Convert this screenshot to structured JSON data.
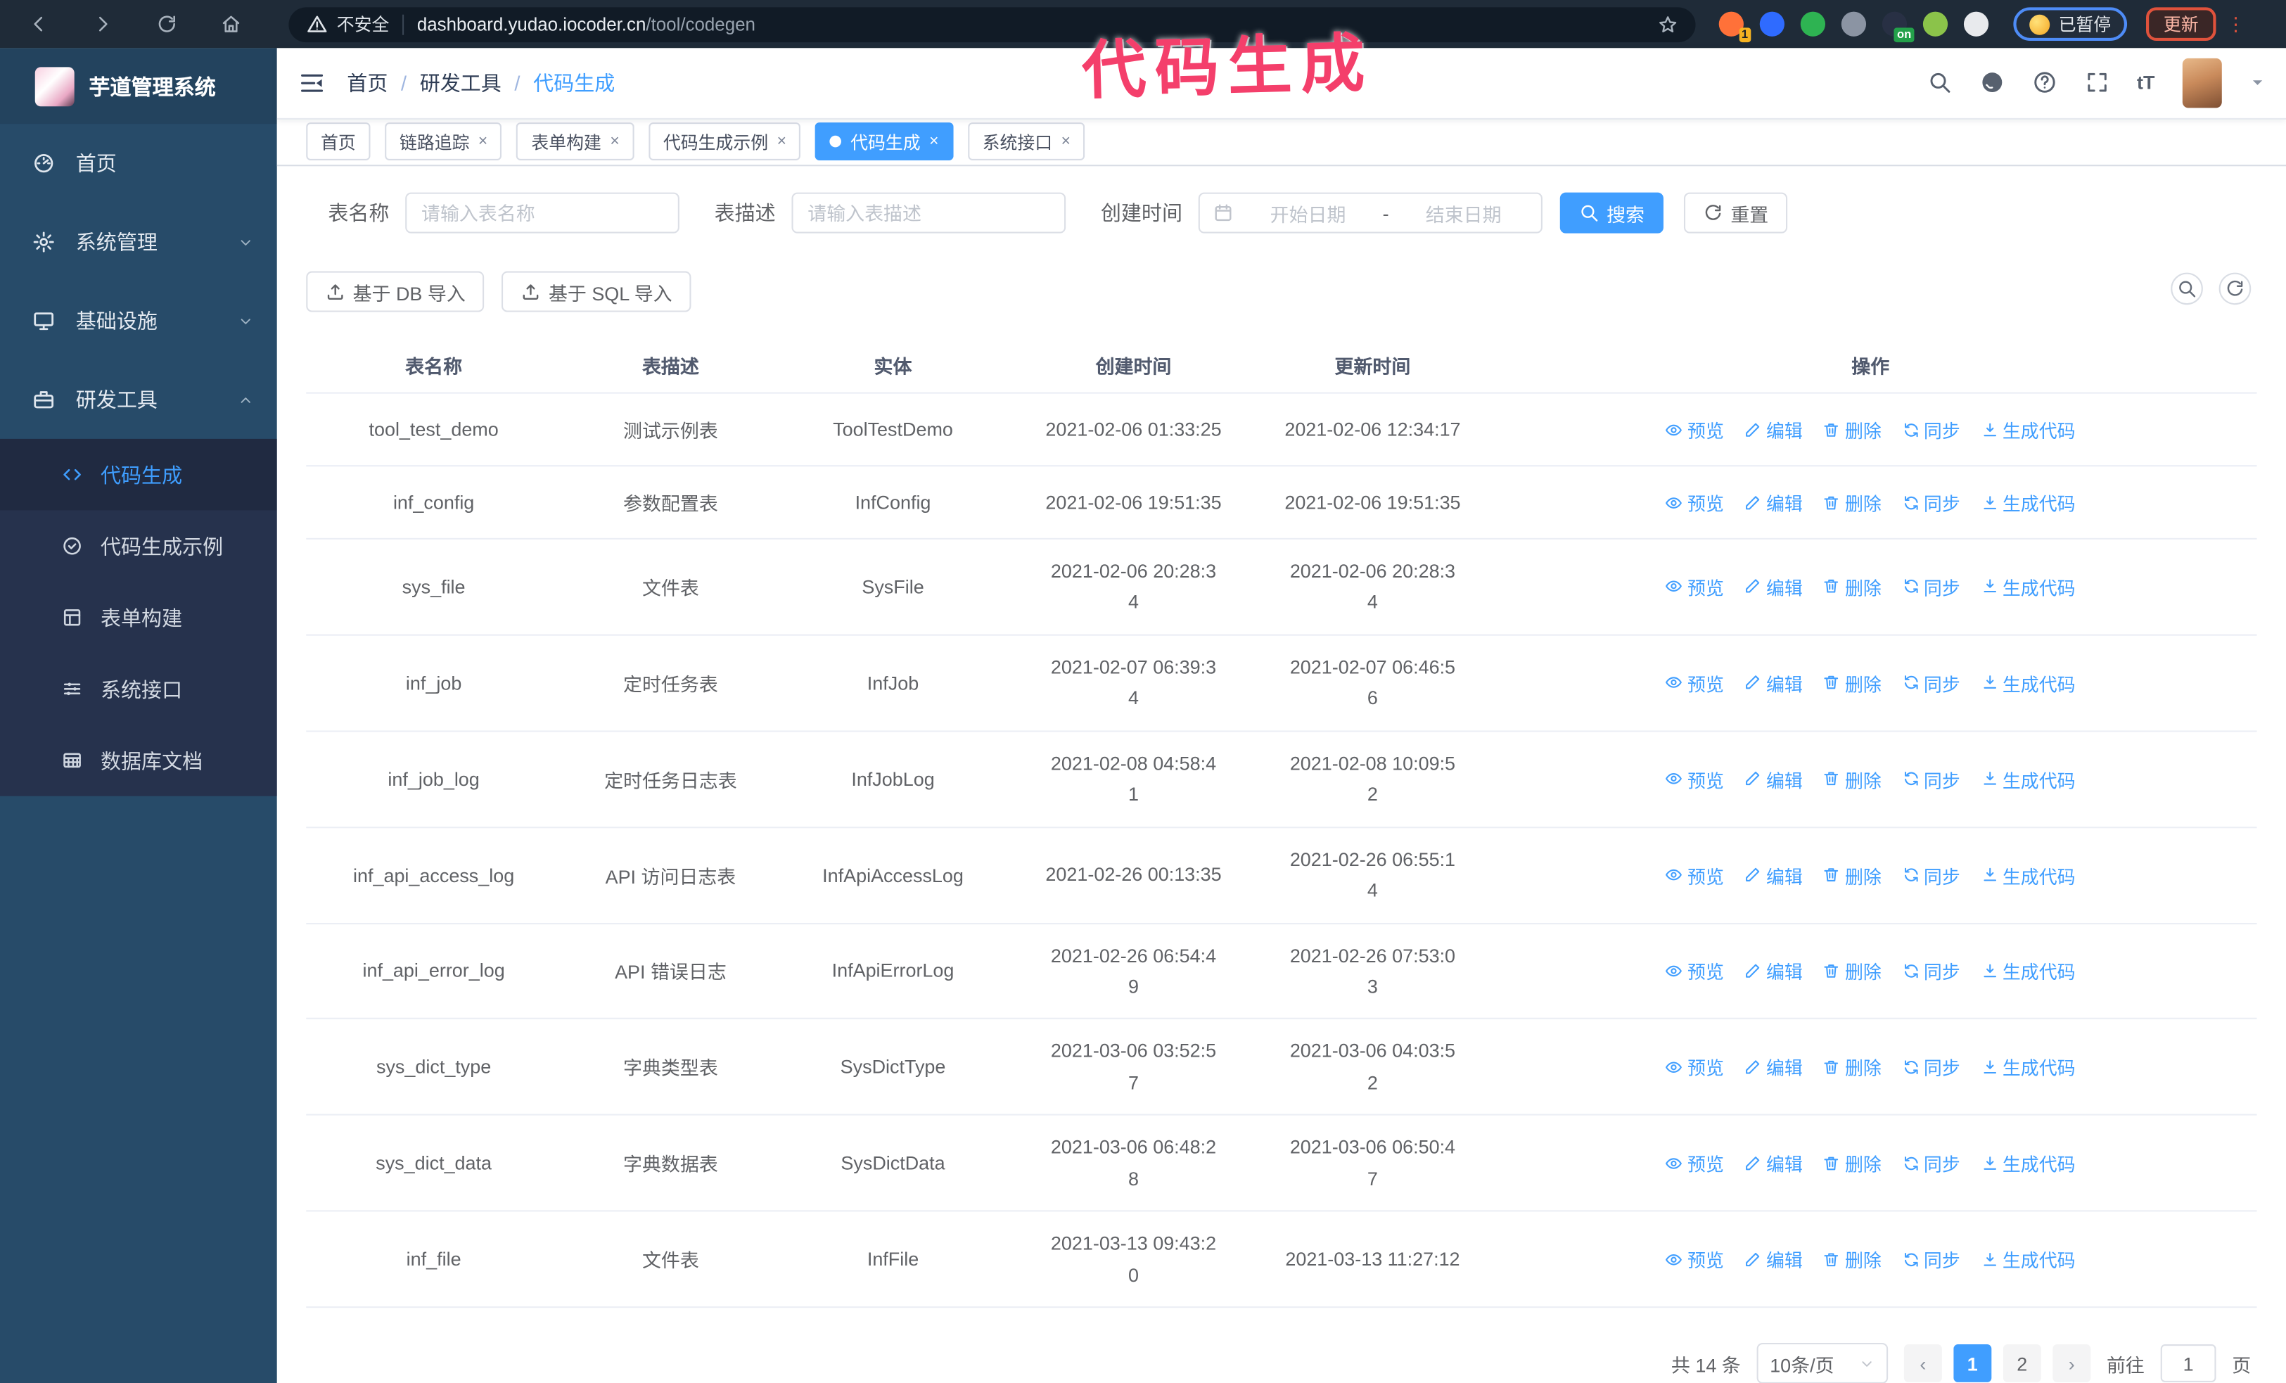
{
  "browser": {
    "security_label": "不安全",
    "url_host": "dashboard.yudao.iocoder.cn",
    "url_path": "/tool/codegen",
    "paused_badge": "已暂停",
    "update_label": "更新",
    "extensions": [
      {
        "icon": "adblock-extension-icon",
        "color": "#ff7139",
        "badge": "1"
      },
      {
        "icon": "gem-extension-icon",
        "color": "#2f6bff",
        "badge": ""
      },
      {
        "icon": "shield-check-extension-icon",
        "color": "#2eb352",
        "badge": ""
      },
      {
        "icon": "grid-extension-icon",
        "color": "#8b94a3",
        "badge": ""
      },
      {
        "icon": "dark-on-extension-icon",
        "color": "#283044",
        "badge": "on"
      },
      {
        "icon": "android-extension-icon",
        "color": "#8bc34a",
        "badge": ""
      },
      {
        "icon": "puzzle-extension-icon",
        "color": "#e8eaed",
        "badge": ""
      }
    ]
  },
  "annotation": {
    "text": "代码生成",
    "color": "#f43f6b"
  },
  "sidebar": {
    "title": "芋道管理系统",
    "items": [
      {
        "label": "首页",
        "icon": "dashboard-icon",
        "chevron": ""
      },
      {
        "label": "系统管理",
        "icon": "gear-icon",
        "chevron": "down"
      },
      {
        "label": "基础设施",
        "icon": "monitor-icon",
        "chevron": "down"
      },
      {
        "label": "研发工具",
        "icon": "briefcase-icon",
        "chevron": "up"
      }
    ],
    "submenu": [
      {
        "label": "代码生成",
        "icon": "code-icon",
        "active": true
      },
      {
        "label": "代码生成示例",
        "icon": "badge-check-icon",
        "active": false
      },
      {
        "label": "表单构建",
        "icon": "form-icon",
        "active": false
      },
      {
        "label": "系统接口",
        "icon": "sliders-icon",
        "active": false
      },
      {
        "label": "数据库文档",
        "icon": "database-doc-icon",
        "active": false
      }
    ]
  },
  "breadcrumb": {
    "0": "首页",
    "1": "研发工具",
    "2": "代码生成"
  },
  "tabs": [
    {
      "label": "首页",
      "closable": false,
      "active": false
    },
    {
      "label": "链路追踪",
      "closable": true,
      "active": false
    },
    {
      "label": "表单构建",
      "closable": true,
      "active": false
    },
    {
      "label": "代码生成示例",
      "closable": true,
      "active": false
    },
    {
      "label": "代码生成",
      "closable": true,
      "active": true
    },
    {
      "label": "系统接口",
      "closable": true,
      "active": false
    }
  ],
  "filters": {
    "name_label": "表名称",
    "name_placeholder": "请输入表名称",
    "desc_label": "表描述",
    "desc_placeholder": "请输入表描述",
    "time_label": "创建时间",
    "start_placeholder": "开始日期",
    "range_separator": "-",
    "end_placeholder": "结束日期",
    "search_label": "搜索",
    "reset_label": "重置"
  },
  "toolbar": {
    "db_import_label": "基于 DB 导入",
    "sql_import_label": "基于 SQL 导入"
  },
  "table": {
    "headers": [
      "表名称",
      "表描述",
      "实体",
      "创建时间",
      "更新时间",
      "操作"
    ],
    "action_labels": [
      "预览",
      "编辑",
      "删除",
      "同步",
      "生成代码"
    ],
    "action_icons": [
      "eye-icon",
      "edit-icon",
      "delete-icon",
      "sync-icon",
      "download-icon"
    ],
    "rows": [
      {
        "name": "tool_test_demo",
        "desc": "测试示例表",
        "entity": "ToolTestDemo",
        "created": "2021-02-06 01:33:25",
        "updated": "2021-02-06 12:34:17"
      },
      {
        "name": "inf_config",
        "desc": "参数配置表",
        "entity": "InfConfig",
        "created": "2021-02-06 19:51:35",
        "updated": "2021-02-06 19:51:35"
      },
      {
        "name": "sys_file",
        "desc": "文件表",
        "entity": "SysFile",
        "created": "2021-02-06 20:28:3\n4",
        "updated": "2021-02-06 20:28:3\n4"
      },
      {
        "name": "inf_job",
        "desc": "定时任务表",
        "entity": "InfJob",
        "created": "2021-02-07 06:39:3\n4",
        "updated": "2021-02-07 06:46:5\n6"
      },
      {
        "name": "inf_job_log",
        "desc": "定时任务日志表",
        "entity": "InfJobLog",
        "created": "2021-02-08 04:58:4\n1",
        "updated": "2021-02-08 10:09:5\n2"
      },
      {
        "name": "inf_api_access_log",
        "desc": "API 访问日志表",
        "entity": "InfApiAccessLog",
        "created": "2021-02-26 00:13:35",
        "updated": "2021-02-26 06:55:1\n4"
      },
      {
        "name": "inf_api_error_log",
        "desc": "API 错误日志",
        "entity": "InfApiErrorLog",
        "created": "2021-02-26 06:54:4\n9",
        "updated": "2021-02-26 07:53:0\n3"
      },
      {
        "name": "sys_dict_type",
        "desc": "字典类型表",
        "entity": "SysDictType",
        "created": "2021-03-06 03:52:5\n7",
        "updated": "2021-03-06 04:03:5\n2"
      },
      {
        "name": "sys_dict_data",
        "desc": "字典数据表",
        "entity": "SysDictData",
        "created": "2021-03-06 06:48:2\n8",
        "updated": "2021-03-06 06:50:4\n7"
      },
      {
        "name": "inf_file",
        "desc": "文件表",
        "entity": "InfFile",
        "created": "2021-03-13 09:43:2\n0",
        "updated": "2021-03-13 11:27:12"
      }
    ]
  },
  "pagination": {
    "total": "共 14 条",
    "per_page": "10条/页",
    "pages": [
      "1",
      "2"
    ],
    "active_page": "1",
    "goto_label": "前往",
    "goto_value": "1",
    "page_suffix": "页"
  },
  "colors": {
    "accent": "#409EFF",
    "sidebar_bg": "#274b69",
    "submenu_bg": "#26324d",
    "chrome_bg": "#1f2b38",
    "annotation_pink": "#f43f6b"
  }
}
